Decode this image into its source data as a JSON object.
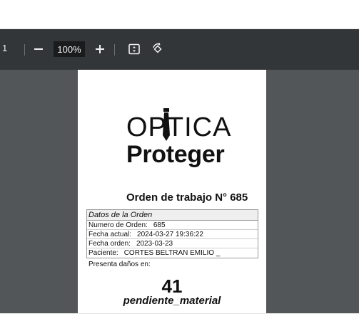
{
  "toolbar": {
    "page_number": "1",
    "zoom_level": "100%",
    "zoom_out_icon": "minus-icon",
    "zoom_in_icon": "plus-icon",
    "fit_page_icon": "fit-page-icon",
    "rotate_icon": "rotate-icon"
  },
  "document": {
    "logo_line1": "OPTICA",
    "logo_line2": "Proteger",
    "order_title": "Orden de trabajo N° 685",
    "datos": {
      "header": "Datos de la Orden",
      "rows": [
        {
          "label": "Numero de Orden:",
          "value": "685"
        },
        {
          "label": "Fecha actual:",
          "value": "2024-03-27 19:36:22"
        },
        {
          "label": "Fecha orden:",
          "value": "2023-03-23"
        },
        {
          "label": "Paciente:",
          "value": "CORTES BELTRAN EMILIO _"
        }
      ]
    },
    "presenta_label": "Presenta daños en:",
    "damage_number": "41",
    "status": "pendiente_material"
  }
}
